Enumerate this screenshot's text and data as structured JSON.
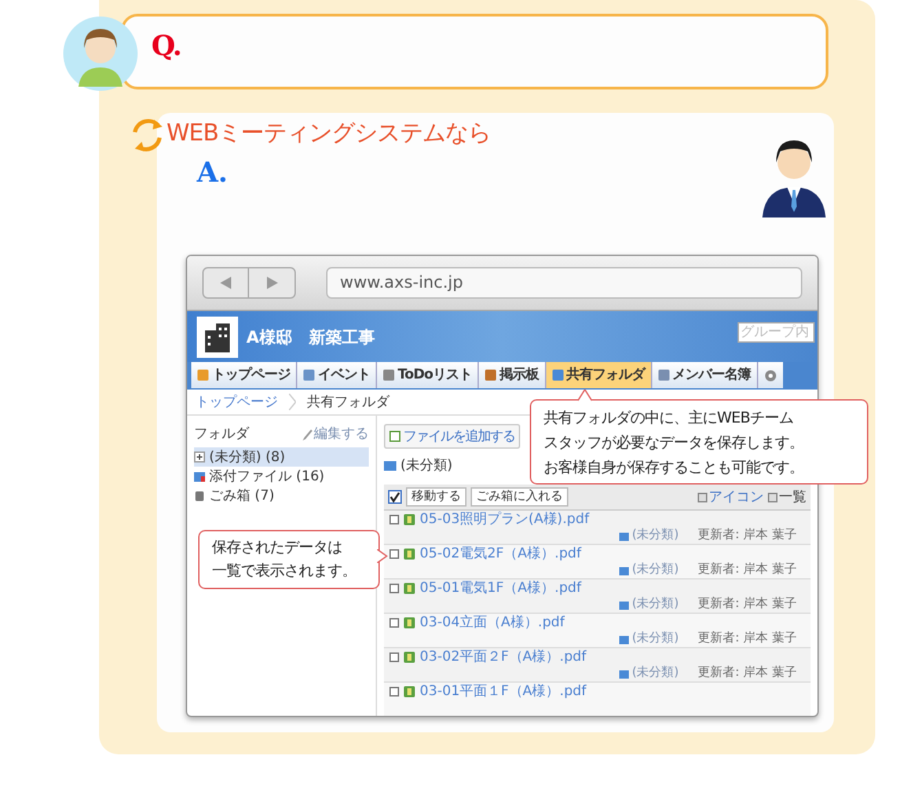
{
  "question": {
    "label": "Q."
  },
  "answer": {
    "heading": "WEBミーティングシステムなら",
    "label": "A."
  },
  "browser": {
    "url": "www.axs-inc.jp"
  },
  "app": {
    "title": "A様邸　新築工事",
    "search_placeholder": "グループ内",
    "nav": [
      {
        "label": "トップページ",
        "selected": false
      },
      {
        "label": "イベント",
        "selected": false
      },
      {
        "label": "ToDoリスト",
        "selected": false
      },
      {
        "label": "掲示板",
        "selected": false
      },
      {
        "label": "共有フォルダ",
        "selected": true
      },
      {
        "label": "メンバー名簿",
        "selected": false
      }
    ],
    "breadcrumb": [
      "トップページ",
      "共有フォルダ"
    ]
  },
  "sidebar": {
    "title": "フォルダ",
    "edit_link": "編集する",
    "folders": [
      {
        "label": "(未分類) (8)",
        "kind": "expandable",
        "selected": true
      },
      {
        "label": "添付ファイル (16)",
        "kind": "attachment",
        "selected": false
      },
      {
        "label": "ごみ箱 (7)",
        "kind": "trash",
        "selected": false
      }
    ]
  },
  "content": {
    "add_button": "ファイルを追加する",
    "current_folder": "(未分類)",
    "select_all_checked": true,
    "actions": [
      "移動する",
      "ごみ箱に入れる"
    ],
    "view_options": [
      "アイコン",
      "一覧"
    ],
    "files": [
      {
        "name": "05-03照明プラン(A様).pdf",
        "folder": "(未分類)",
        "updater": "更新者: 岸本 葉子",
        "checked": false
      },
      {
        "name": "05-02電気2F（A様）.pdf",
        "folder": "(未分類)",
        "updater": "更新者: 岸本 葉子",
        "checked": false
      },
      {
        "name": "05-01電気1F（A様）.pdf",
        "folder": "(未分類)",
        "updater": "更新者: 岸本 葉子",
        "checked": false
      },
      {
        "name": "03-04立面（A様）.pdf",
        "folder": "(未分類)",
        "updater": "更新者: 岸本 葉子",
        "checked": false
      },
      {
        "name": "03-02平面２F（A様）.pdf",
        "folder": "(未分類)",
        "updater": "更新者: 岸本 葉子",
        "checked": false
      },
      {
        "name": "03-01平面１F（A様）.pdf",
        "checked": false
      }
    ]
  },
  "callouts": [
    {
      "lines": [
        "共有フォルダの中に、主にWEBチーム",
        "スタッフが必要なデータを保存します。",
        "お客様自身が保存することも可能です。"
      ],
      "kind": "above"
    },
    {
      "lines": [
        "保存されたデータは",
        "一覧で表示されます。"
      ],
      "kind": "side"
    }
  ]
}
